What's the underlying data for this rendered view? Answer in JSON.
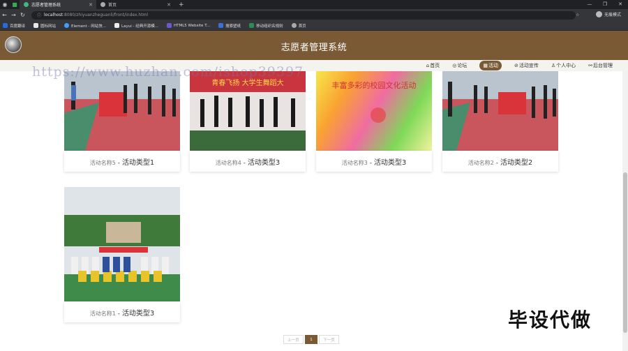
{
  "browser": {
    "tabs": [
      {
        "title": "志愿者管理系统",
        "active": true
      },
      {
        "title": "首页",
        "active": false
      }
    ],
    "url_host": "localhost",
    "url_path": ":8080/zhiyuanzheguanli/front/index.html",
    "profile_label": "无痕模式",
    "bookmarks": [
      "百度翻译",
      "圆标网站",
      "Element - 网站快...",
      "Layui - 经典开源模...",
      "HTML5 Website T...",
      "搜索壁纸",
      "移动组织名规则",
      "首页"
    ]
  },
  "site": {
    "title": "志愿者管理系统",
    "nav": [
      {
        "icon": "home-icon",
        "glyph": "⌂",
        "label": "首页",
        "active": false
      },
      {
        "icon": "forum-icon",
        "glyph": "◎",
        "label": "论坛",
        "active": false
      },
      {
        "icon": "activity-icon",
        "glyph": "▦",
        "label": "活动",
        "active": true
      },
      {
        "icon": "tag-icon",
        "glyph": "⊘",
        "label": "活动宣传",
        "active": false
      },
      {
        "icon": "user-icon",
        "glyph": "♙",
        "label": "个人中心",
        "active": false
      },
      {
        "icon": "link-icon",
        "glyph": "⚯",
        "label": "后台管理",
        "active": false
      }
    ]
  },
  "watermark": "https://www.huzhan.com/ishop39397",
  "cards": [
    {
      "name": "活动名称5",
      "separator": "-",
      "type": "活动类型1"
    },
    {
      "name": "活动名称4",
      "separator": "-",
      "type": "活动类型3",
      "banner": "青春飞扬 大学生舞蹈大"
    },
    {
      "name": "活动名称3",
      "separator": "-",
      "type": "活动类型3",
      "banner": "丰富多彩的校园文化活动"
    },
    {
      "name": "活动名称2",
      "separator": "-",
      "type": "活动类型2"
    },
    {
      "name": "活动名称1",
      "separator": "-",
      "type": "活动类型3"
    }
  ],
  "pager": {
    "prev": "上一页",
    "current": "1",
    "next": "下一页"
  },
  "promo": "毕设代做"
}
